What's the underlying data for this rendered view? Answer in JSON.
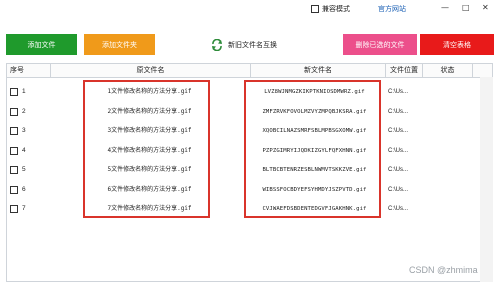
{
  "topbar": {
    "compat_label": "兼容模式",
    "website_label": "官方网站",
    "minimize_glyph": "—",
    "maximize_glyph": "□",
    "close_glyph": "✕"
  },
  "toolbar": {
    "add_file": "添加文件",
    "add_folder": "添加文件夹",
    "swap": "新旧文件名互换",
    "swap_icon": "swap-refresh-icon",
    "delete_selected": "删除已选的文件",
    "clear_table": "清空表格"
  },
  "colors": {
    "add_file": "#1f9a2c",
    "add_folder": "#f09a1a",
    "delete_selected": "#ec4f8b",
    "clear_table": "#e81a1a",
    "highlight": "#d9342b"
  },
  "table": {
    "headers": {
      "index": "序号",
      "original": "原文件名",
      "new": "新文件名",
      "location": "文件位置",
      "status": "状态"
    },
    "rows": [
      {
        "index": "1",
        "original": "1文件修改名称的方法分享.gif",
        "new": "LVZ8WJNMGZKIKPTKNIOSDMWRZ.gif",
        "location": "C:\\Us..."
      },
      {
        "index": "2",
        "original": "2文件修改名称的方法分享.gif",
        "new": "ZMFZRVKFOVOLMZVYZMPQBJKSRA.gif",
        "location": "C:\\Us..."
      },
      {
        "index": "3",
        "original": "3文件修改名称的方法分享.gif",
        "new": "XQOBCILNAZSMRFSBLMPBSGXOMW.gif",
        "location": "C:\\Us..."
      },
      {
        "index": "4",
        "original": "4文件修改名称的方法分享.gif",
        "new": "PZPZGIMRYIJQDKIZGYLFQFXHNN.gif",
        "location": "C:\\Us..."
      },
      {
        "index": "5",
        "original": "5文件修改名称的方法分享.gif",
        "new": "BLTBCBTENRZESBLNWMVTSKKZVE.gif",
        "location": "C:\\Us..."
      },
      {
        "index": "6",
        "original": "6文件修改名称的方法分享.gif",
        "new": "WIBSSFOCBDYEFSYHMDYJSZPVTD.gif",
        "location": "C:\\Us..."
      },
      {
        "index": "7",
        "original": "7文件修改名称的方法分享.gif",
        "new": "CVJWAEFDSBDENTEDGVFJGAKHNK.gif",
        "location": "C:\\Us..."
      }
    ]
  },
  "watermark": "CSDN @zhmima"
}
